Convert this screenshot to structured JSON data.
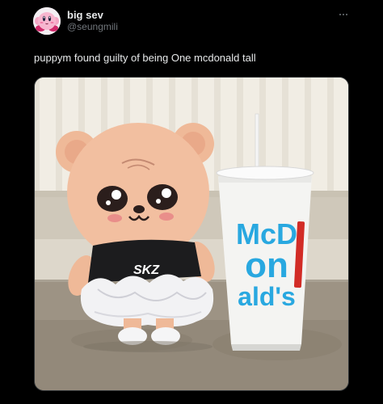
{
  "author": {
    "display_name": "big sev",
    "handle": "@seungmili",
    "avatar_icon": "kirby-avatar-icon"
  },
  "tweet": {
    "text": "puppym found guilty of being One mcdonald tall"
  },
  "media": {
    "cup_brand_lines": [
      "McD",
      "on",
      "ald's"
    ],
    "shirt_logo": "SKZ"
  },
  "colors": {
    "background": "#000000",
    "text_primary": "#e7e9ea",
    "text_secondary": "#71767b",
    "cup_blue": "#29a8e0",
    "cup_red": "#d22c26",
    "plush_skin": "#f2bfa0"
  }
}
